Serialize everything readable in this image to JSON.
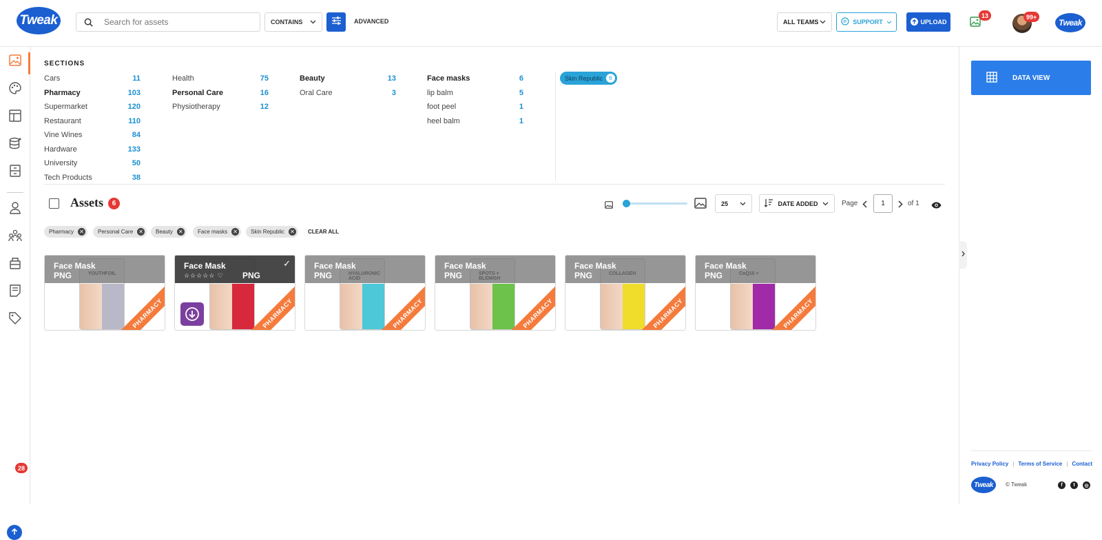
{
  "header": {
    "logo": "Tweak",
    "search_placeholder": "Search for assets",
    "contains_label": "CONTAINS",
    "advanced_label": "ADVANCED",
    "teams_label": "ALL TEAMS",
    "support_label": "SUPPORT",
    "upload_label": "UPLOAD",
    "notifications_count": "13",
    "messages_count": "99+"
  },
  "sidebar": {
    "upload_count": "28"
  },
  "sections": {
    "title": "SECTIONS",
    "columns": [
      [
        {
          "label": "Cars",
          "count": "11"
        },
        {
          "label": "Pharmacy",
          "count": "103"
        },
        {
          "label": "Supermarket",
          "count": "120"
        },
        {
          "label": "Restaurant",
          "count": "110"
        },
        {
          "label": "Vine Wines",
          "count": "84"
        },
        {
          "label": "Hardware",
          "count": "133"
        },
        {
          "label": "University",
          "count": "50"
        },
        {
          "label": "Tech Products",
          "count": "38"
        }
      ],
      [
        {
          "label": "Health",
          "count": "75"
        },
        {
          "label": "Personal Care",
          "count": "16"
        },
        {
          "label": "Physiotherapy",
          "count": "12"
        }
      ],
      [
        {
          "label": "Beauty",
          "count": "13"
        },
        {
          "label": "Oral Care",
          "count": "3"
        }
      ],
      [
        {
          "label": "Face masks",
          "count": "6"
        },
        {
          "label": "lip balm",
          "count": "5"
        },
        {
          "label": "foot peel",
          "count": "1"
        },
        {
          "label": "heel balm",
          "count": "1"
        }
      ]
    ],
    "selected_brand": {
      "label": "Skin Republic",
      "count": "6"
    }
  },
  "assets": {
    "title": "Assets",
    "count": "6",
    "per_page": "25",
    "sort_label": "DATE ADDED",
    "page_label": "Page",
    "page_value": "1",
    "page_of": "of 1",
    "filters": [
      "Pharmacy",
      "Personal Care",
      "Beauty",
      "Face masks",
      "Skin Republic"
    ],
    "clear_all": "CLEAR ALL",
    "cards": [
      {
        "name": "Face Mask",
        "ext": "PNG",
        "product": "YOUTHFOIL",
        "ribbon": "PHARMACY",
        "color": "#b8b8c8"
      },
      {
        "name": "Face Mask",
        "ext": "PNG",
        "product": "",
        "ribbon": "PHARMACY",
        "color": "#d8283c",
        "stars": "☆☆☆☆☆ ♡"
      },
      {
        "name": "Face Mask",
        "ext": "PNG",
        "product": "HYALURONIC ACID",
        "ribbon": "PHARMACY",
        "color": "#4cc8d8"
      },
      {
        "name": "Face Mask",
        "ext": "PNG",
        "product": "SPOTS + BLEMISH",
        "ribbon": "PHARMACY",
        "color": "#6cc24a"
      },
      {
        "name": "Face Mask",
        "ext": "PNG",
        "product": "COLLAGEN",
        "ribbon": "PHARMACY",
        "color": "#f0dc2a"
      },
      {
        "name": "Face Mask",
        "ext": "PNG",
        "product": "CoQ10 +",
        "ribbon": "PHARMACY",
        "color": "#a02aa8"
      }
    ]
  },
  "right_panel": {
    "data_view_label": "DATA VIEW",
    "footer_links": [
      "Privacy Policy",
      "Terms of Service",
      "Contact"
    ],
    "copyright": "© Tweak"
  },
  "colors": {
    "primary": "#1b5fd1",
    "accent": "#f47b3c",
    "count": "#1a8fd1"
  }
}
